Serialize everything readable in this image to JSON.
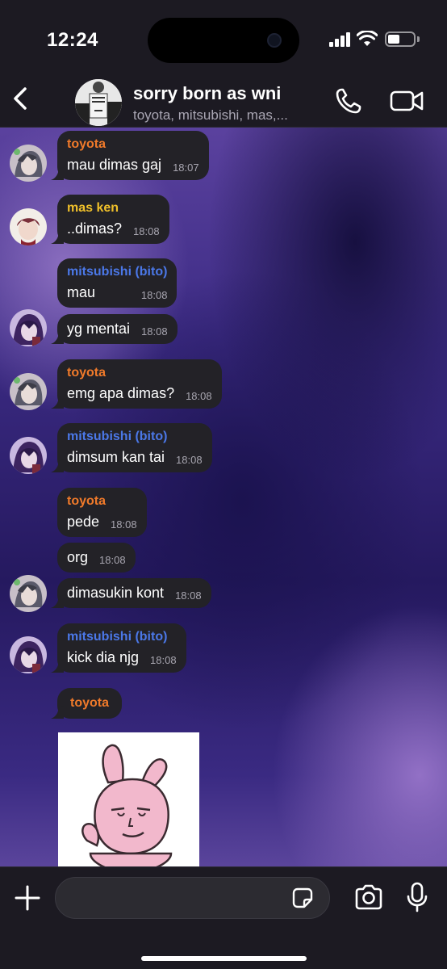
{
  "status_bar": {
    "time": "12:24",
    "battery_level": 0.45
  },
  "header": {
    "title": "sorry born as wni",
    "subtitle": "toyota, mitsubishi, mas,...",
    "back_icon": "chevron-left-icon",
    "call_icon": "phone-icon",
    "video_icon": "video-camera-icon"
  },
  "colors": {
    "toyota": "#f07a2a",
    "mas_ken": "#f0c02a",
    "mitsubishi": "#4b78e8",
    "bubble": "#232227"
  },
  "messages": [
    {
      "sender": "toyota",
      "text": "mau dimas gaj",
      "time": "18:07"
    },
    {
      "sender": "mas ken",
      "text": "..dimas?",
      "time": "18:08"
    },
    {
      "sender": "mitsubishi (bito)",
      "text": "mau",
      "time": "18:08"
    },
    {
      "sender": "",
      "text": "yg mentai",
      "time": "18:08"
    },
    {
      "sender": "toyota",
      "text": "emg apa dimas?",
      "time": "18:08"
    },
    {
      "sender": "mitsubishi (bito)",
      "text": "dimsum kan tai",
      "time": "18:08"
    },
    {
      "sender": "toyota",
      "text": "pede",
      "time": "18:08"
    },
    {
      "sender": "",
      "text": "org",
      "time": "18:08"
    },
    {
      "sender": "",
      "text": "dimasukin kont",
      "time": "18:08"
    },
    {
      "sender": "mitsubishi (bito)",
      "text": "kick dia njg",
      "time": "18:08"
    },
    {
      "sender": "toyota",
      "text": "",
      "time": ""
    }
  ],
  "sticker": {
    "icon": "pink-bunny-sticker"
  },
  "composer": {
    "placeholder": "",
    "plus_icon": "plus-icon",
    "sticker_icon": "sticker-icon",
    "camera_icon": "camera-icon",
    "mic_icon": "microphone-icon"
  }
}
